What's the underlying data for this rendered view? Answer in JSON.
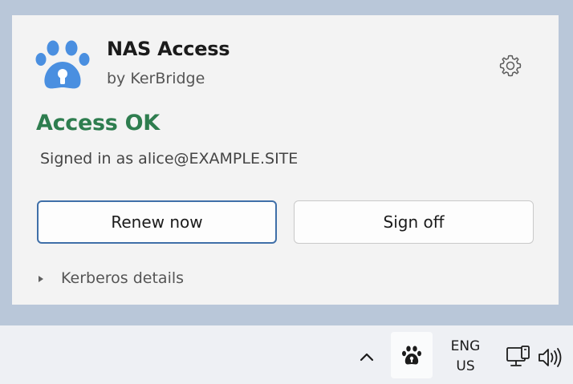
{
  "flyout": {
    "app_name": "NAS Access",
    "vendor": "by KerBridge",
    "status": "Access OK",
    "signed_in_text": "Signed in as alice@EXAMPLE.SITE",
    "renew_label": "Renew now",
    "signoff_label": "Sign off",
    "details_label": "Kerberos details"
  },
  "taskbar": {
    "language_line1": "ENG",
    "language_line2": "US"
  },
  "icons": {
    "logo": "paw-lock-icon",
    "settings": "gear-icon",
    "tray_chevron": "chevron-up-icon",
    "tray_app": "paw-icon",
    "network": "network-icon",
    "volume": "speaker-icon"
  },
  "colors": {
    "status_ok": "#2e7d4f",
    "logo_blue": "#4a8fe0",
    "primary_border": "#3f6fa8"
  }
}
